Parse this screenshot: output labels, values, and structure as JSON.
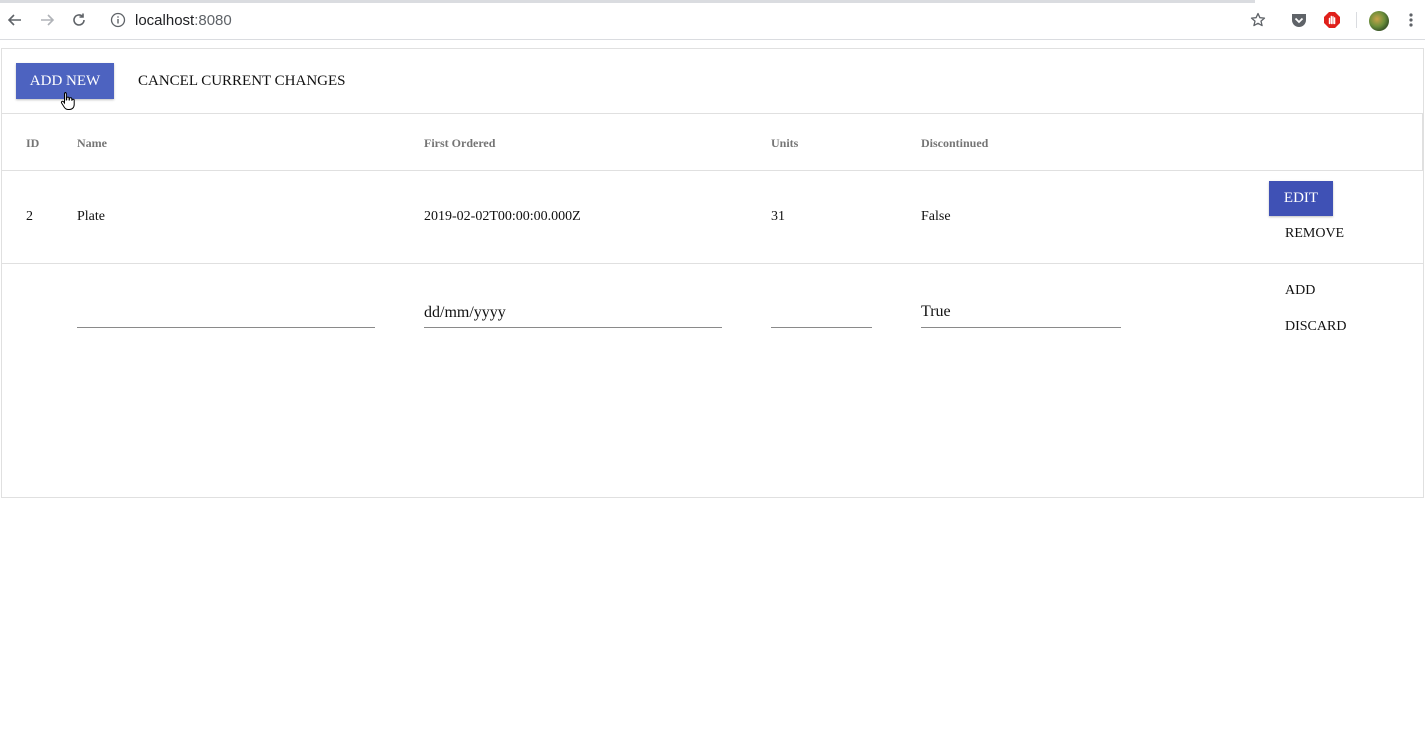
{
  "browser": {
    "url_host": "localhost",
    "url_port": ":8080"
  },
  "toolbar": {
    "add_new_label": "ADD NEW",
    "cancel_label": "CANCEL CURRENT CHANGES"
  },
  "table": {
    "columns": [
      "ID",
      "Name",
      "First Ordered",
      "Units",
      "Discontinued"
    ],
    "rows": [
      {
        "id": "2",
        "name": "Plate",
        "first_ordered": "2019-02-02T00:00:00.000Z",
        "units": "31",
        "discontinued": "False",
        "edit_label": "EDIT",
        "remove_label": "REMOVE"
      }
    ],
    "new_row": {
      "name_value": "",
      "date_placeholder": "dd/mm/yyyy",
      "units_value": "",
      "discontinued_value": "True",
      "add_label": "ADD",
      "discard_label": "DISCARD"
    }
  },
  "colors": {
    "primary": "#4d63c0",
    "edit_button": "#3f51b5"
  }
}
